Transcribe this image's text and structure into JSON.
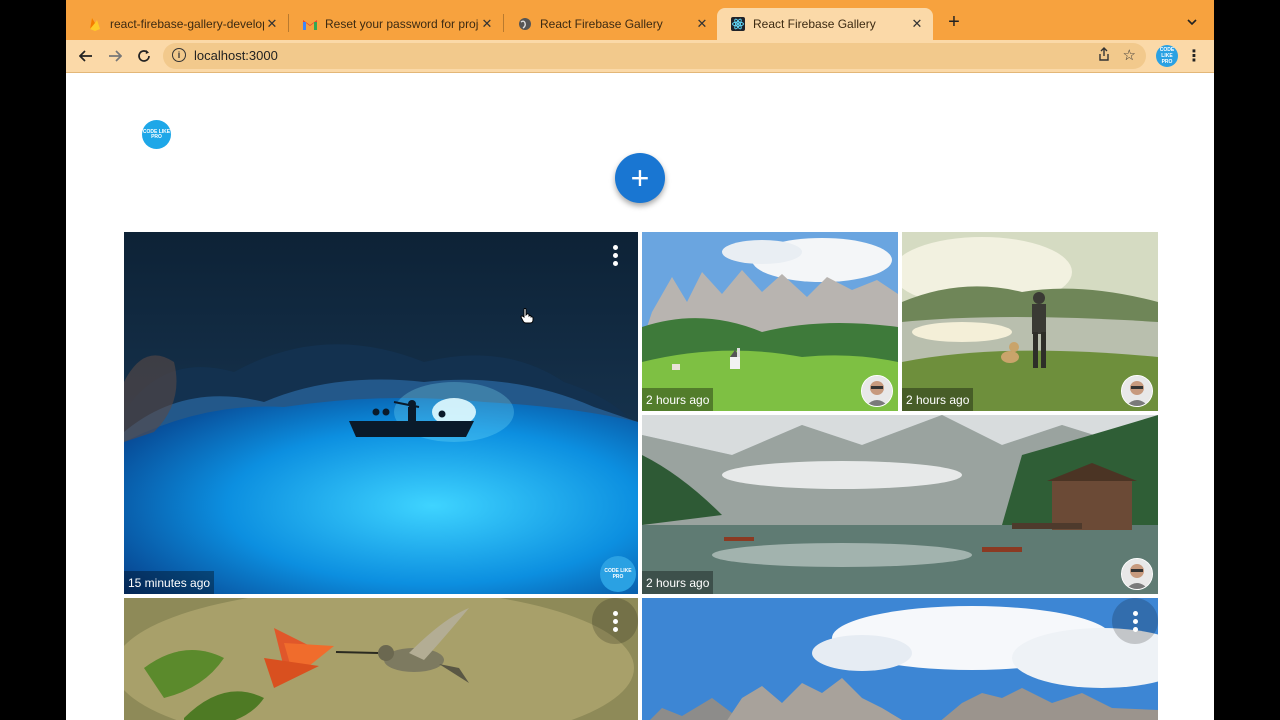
{
  "browser": {
    "tabs": [
      {
        "label": "react-firebase-gallery-develop",
        "icon": "firebase-icon"
      },
      {
        "label": "Reset your password for proje",
        "icon": "gmail-icon"
      },
      {
        "label": "React Firebase Gallery",
        "icon": "globe-icon"
      },
      {
        "label": "React Firebase Gallery",
        "icon": "react-icon",
        "active": true
      }
    ],
    "url": "localhost:3000",
    "profile_text": "CODE LIKE PRO"
  },
  "page": {
    "user_avatar_text": "CODE LIKE PRO",
    "add_button_label": "+"
  },
  "gallery": [
    {
      "time": "15 minutes ago",
      "owner": "brand",
      "owner_text": "CODE LIKE PRO",
      "image": "blue-grotto-cave-boat"
    },
    {
      "time": "2 hours ago",
      "owner": "photo",
      "image": "dolomites-village-meadow"
    },
    {
      "time": "2 hours ago",
      "owner": "photo",
      "image": "hiker-with-dog-lake-view"
    },
    {
      "time": "2 hours ago",
      "owner": "photo",
      "image": "lake-braies-boathouse"
    },
    {
      "time": "",
      "owner": "",
      "image": "hummingbird-flower"
    },
    {
      "time": "",
      "owner": "",
      "image": "mountain-peaks-sky"
    }
  ],
  "colors": {
    "tabstrip": "#f7a23e",
    "toolbar": "#fbd9a8",
    "fab": "#1976d2",
    "brand": "#2aa1e3"
  }
}
